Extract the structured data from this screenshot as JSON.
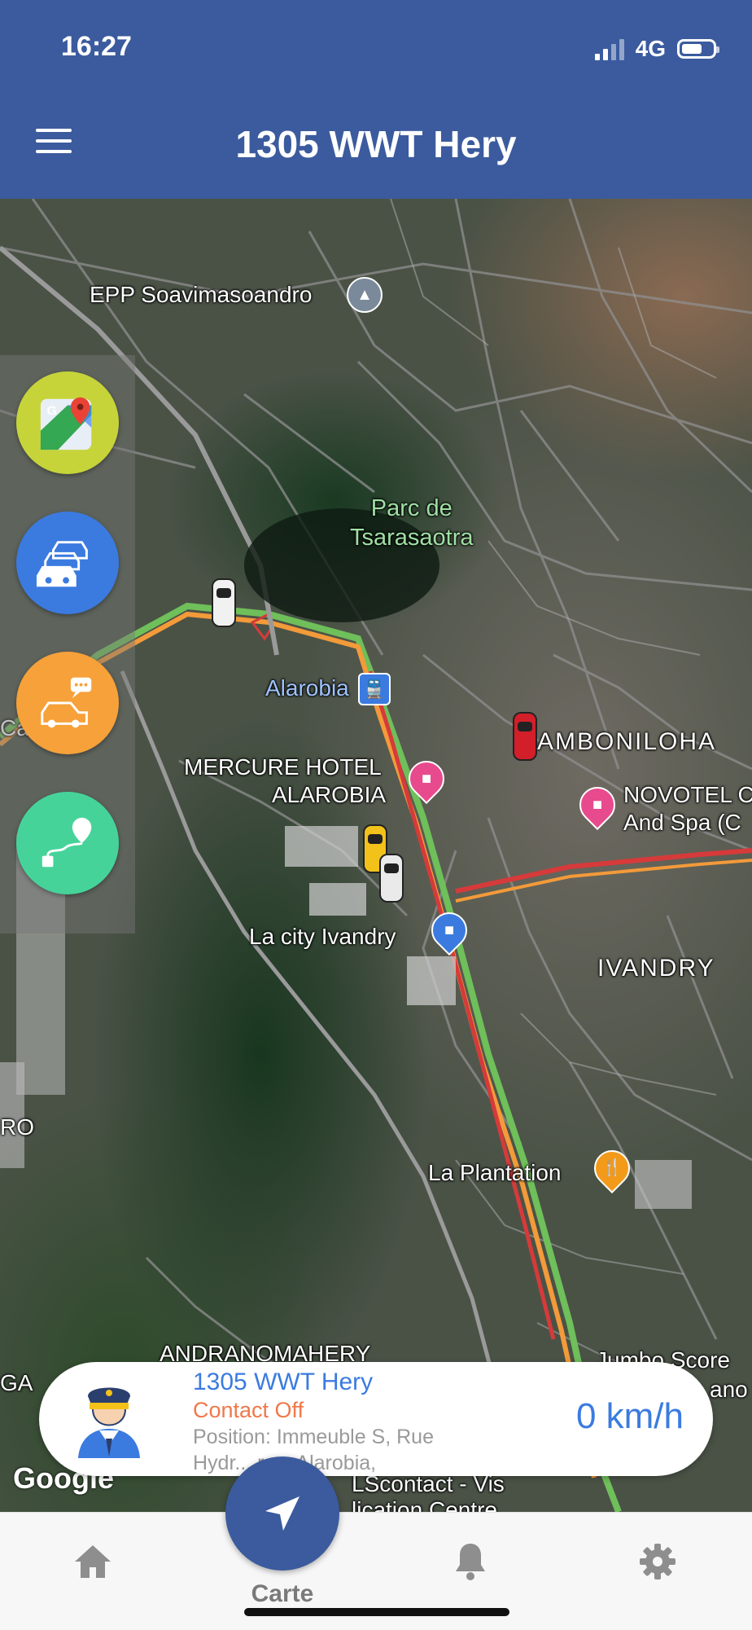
{
  "status_bar": {
    "time": "16:27",
    "network": "4G"
  },
  "header": {
    "title": "1305 WWT Hery"
  },
  "map": {
    "labels": {
      "school": "EPP Soavimasoandro",
      "park_line1": "Parc de",
      "park_line2": "Tsarasaotra",
      "station": "Alarobia",
      "hotel_line1": "MERCURE HOTEL",
      "hotel_line2": "ALAROBIA",
      "amboniloha": "AMBONILOHA",
      "novotel_line1": "NOVOTEL C",
      "novotel_line2": "And Spa (C",
      "la_city": "La city Ivandry",
      "ivandry": "IVANDRY",
      "la_plantation": "La Plantation",
      "ro": "RO",
      "ca": "Ca",
      "andranomahery": "ANDRANOMAHERY",
      "ga": "GA",
      "jumbo": "Jumbo Score",
      "ano": "ano",
      "lscontact": "LScontact - Vis",
      "lication": "lication Centre"
    },
    "attribution": "Google"
  },
  "side_actions": [
    {
      "name": "google-maps-button",
      "icon": "google-maps-icon",
      "color": "#c6d43a"
    },
    {
      "name": "traffic-button",
      "icon": "traffic-cars-icon",
      "color": "#3b7be0"
    },
    {
      "name": "car-message-button",
      "icon": "car-chat-icon",
      "color": "#f6a13a"
    },
    {
      "name": "route-button",
      "icon": "route-icon",
      "color": "#46d39a"
    }
  ],
  "vehicle_card": {
    "name": "1305 WWT Hery",
    "status": "Contact Off",
    "position": "Position: Immeuble S, Rue Hydr... res, Alarobia,",
    "speed": "0 km/h"
  },
  "bottom_nav": {
    "center_label": "Carte",
    "items": [
      {
        "name": "home",
        "icon": "home-icon"
      },
      {
        "name": "map",
        "icon": "navigation-arrow-icon"
      },
      {
        "name": "notifications",
        "icon": "bell-icon"
      },
      {
        "name": "settings",
        "icon": "gear-icon"
      }
    ]
  },
  "colors": {
    "header": "#3b5b9e",
    "accent": "#3b7be0",
    "status_off": "#f0784a"
  }
}
